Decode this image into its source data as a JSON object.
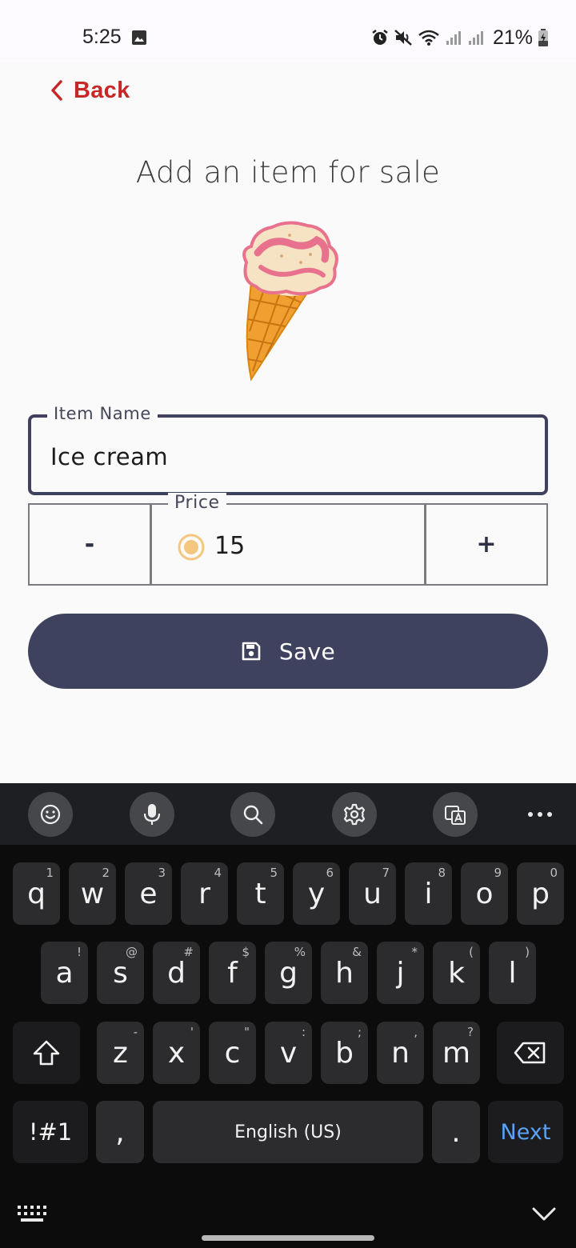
{
  "status_bar": {
    "time": "5:25",
    "battery": "21%",
    "icons": [
      "gallery-icon",
      "alarm-icon",
      "mute-icon",
      "wifi-icon",
      "signal-icon",
      "signal-icon",
      "battery-charging-icon"
    ]
  },
  "header": {
    "back_label": "Back",
    "title": "Add an item for sale"
  },
  "hero_image": "ice-cream-cone-illustration",
  "form": {
    "item_name_label": "Item Name",
    "item_name_value": "Ice cream",
    "price_label": "Price",
    "price_value": "15",
    "minus_label": "-",
    "plus_label": "+",
    "save_label": "Save"
  },
  "keyboard": {
    "toolbar": [
      "emoji-icon",
      "microphone-icon",
      "search-icon",
      "settings-icon",
      "translate-icon",
      "more-icon"
    ],
    "row1": [
      {
        "k": "q",
        "h": "1"
      },
      {
        "k": "w",
        "h": "2"
      },
      {
        "k": "e",
        "h": "3"
      },
      {
        "k": "r",
        "h": "4"
      },
      {
        "k": "t",
        "h": "5"
      },
      {
        "k": "y",
        "h": "6"
      },
      {
        "k": "u",
        "h": "7"
      },
      {
        "k": "i",
        "h": "8"
      },
      {
        "k": "o",
        "h": "9"
      },
      {
        "k": "p",
        "h": "0"
      }
    ],
    "row2": [
      {
        "k": "a",
        "h": "!"
      },
      {
        "k": "s",
        "h": "@"
      },
      {
        "k": "d",
        "h": "#"
      },
      {
        "k": "f",
        "h": "$"
      },
      {
        "k": "g",
        "h": "%"
      },
      {
        "k": "h",
        "h": "&"
      },
      {
        "k": "j",
        "h": "*"
      },
      {
        "k": "k",
        "h": "("
      },
      {
        "k": "l",
        "h": ")"
      }
    ],
    "row3": [
      {
        "k": "z",
        "h": "-"
      },
      {
        "k": "x",
        "h": "'"
      },
      {
        "k": "c",
        "h": "\""
      },
      {
        "k": "v",
        "h": ":"
      },
      {
        "k": "b",
        "h": ";"
      },
      {
        "k": "n",
        "h": ","
      },
      {
        "k": "m",
        "h": "?"
      }
    ],
    "symbols_label": "!#1",
    "comma_label": ",",
    "space_label": "English (US)",
    "period_label": ".",
    "action_label": "Next",
    "accent_color": "#5aa2f5"
  },
  "colors": {
    "primary": "#3f425e",
    "back_red": "#c62828"
  }
}
